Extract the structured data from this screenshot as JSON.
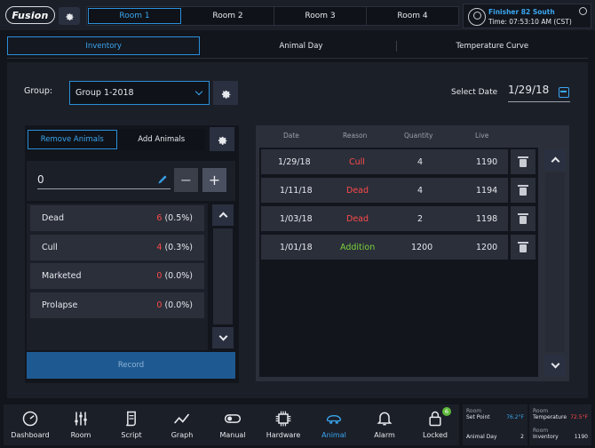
{
  "app": {
    "logo": "Fusion"
  },
  "rooms": [
    "Room 1",
    "Room 2",
    "Room 3",
    "Room 4"
  ],
  "user": {
    "title": "Finisher 82 South",
    "time": "Time: 07:53:10 AM (CST)"
  },
  "tabs": [
    "Inventory",
    "Animal Day",
    "Temperature Curve"
  ],
  "group": {
    "label": "Group:",
    "value": "Group 1-2018"
  },
  "select_date": {
    "label": "Select Date",
    "value": "1/29/18"
  },
  "segment": {
    "remove": "Remove Animals",
    "add": "Add Animals"
  },
  "quantity": {
    "value": "0",
    "minus": "−",
    "plus": "+"
  },
  "reasons": [
    {
      "name": "Dead",
      "count": "6",
      "pct": " (0.5%)"
    },
    {
      "name": "Cull",
      "count": "4",
      "pct": " (0.3%)"
    },
    {
      "name": "Marketed",
      "count": "0",
      "pct": " (0.0%)"
    },
    {
      "name": "Prolapse",
      "count": "0",
      "pct": " (0.0%)"
    }
  ],
  "record_label": "Record",
  "log": {
    "headers": {
      "date": "Date",
      "reason": "Reason",
      "quantity": "Quantity",
      "live": "Live"
    },
    "rows": [
      {
        "date": "1/29/18",
        "reason": "Cull",
        "quantity": "4",
        "live": "1190",
        "color": "#ff4a4a"
      },
      {
        "date": "1/11/18",
        "reason": "Dead",
        "quantity": "4",
        "live": "1194",
        "color": "#ff4a4a"
      },
      {
        "date": "1/03/18",
        "reason": "Dead",
        "quantity": "2",
        "live": "1198",
        "color": "#ff4a4a"
      },
      {
        "date": "1/01/18",
        "reason": "Addition",
        "quantity": "1200",
        "live": "1200",
        "color": "#7bd23a"
      }
    ]
  },
  "nav": [
    {
      "label": "Dashboard",
      "icon": "dashboard-icon"
    },
    {
      "label": "Room",
      "icon": "sliders-icon"
    },
    {
      "label": "Script",
      "icon": "script-icon"
    },
    {
      "label": "Graph",
      "icon": "graph-icon"
    },
    {
      "label": "Manual",
      "icon": "toggle-icon"
    },
    {
      "label": "Hardware",
      "icon": "chip-icon"
    },
    {
      "label": "Animal",
      "icon": "animal-icon"
    },
    {
      "label": "Alarm",
      "icon": "bell-icon"
    },
    {
      "label": "Locked",
      "icon": "lock-icon",
      "badge": "6"
    }
  ],
  "stats": {
    "setpoint_room": "Room",
    "setpoint_label": "Set Point",
    "setpoint_value": "76.2°F",
    "temp_room": "Room",
    "temp_label": "Temperature",
    "temp_value": "72.5°F",
    "animal_day_label": "Animal Day",
    "animal_day_value": "2",
    "inv_room": "Room",
    "inv_label": "Inventory",
    "inv_value": "1190"
  },
  "colors": {
    "accent": "#3aa6f0",
    "danger": "#ff4a4a",
    "success": "#7bd23a"
  }
}
